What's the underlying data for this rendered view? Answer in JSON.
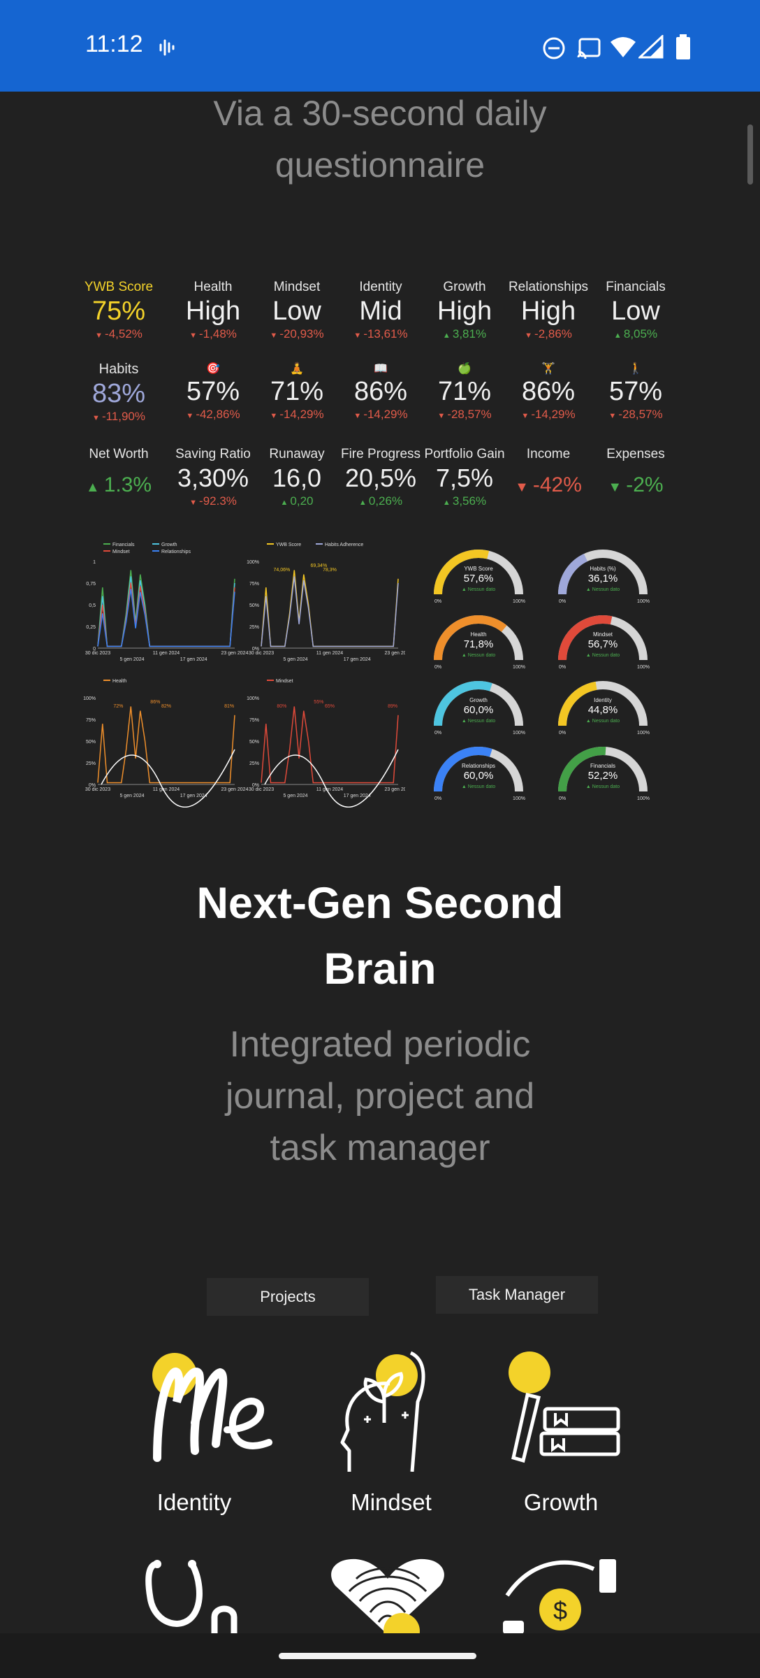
{
  "status_bar": {
    "time": "11:12"
  },
  "hero": {
    "subtitle_line1": "Via a 30-second daily",
    "subtitle_line2": "questionnaire"
  },
  "metrics": {
    "row1": [
      {
        "label": "YWB Score",
        "value": "75%",
        "change": "-4,52%",
        "dir": "down"
      },
      {
        "label": "Health",
        "value": "High",
        "change": "-1,48%",
        "dir": "down"
      },
      {
        "label": "Mindset",
        "value": "Low",
        "change": "-20,93%",
        "dir": "down"
      },
      {
        "label": "Identity",
        "value": "Mid",
        "change": "-13,61%",
        "dir": "down"
      },
      {
        "label": "Growth",
        "value": "High",
        "change": "3,81%",
        "dir": "up"
      },
      {
        "label": "Relationships",
        "value": "High",
        "change": "-2,86%",
        "dir": "down"
      },
      {
        "label": "Financials",
        "value": "Low",
        "change": "8,05%",
        "dir": "up"
      }
    ],
    "row2": [
      {
        "label": "Habits",
        "value": "83%",
        "change": "-11,90%",
        "dir": "down"
      },
      {
        "label": "🎯",
        "value": "57%",
        "change": "-42,86%",
        "dir": "down"
      },
      {
        "label": "🧘",
        "value": "71%",
        "change": "-14,29%",
        "dir": "down"
      },
      {
        "label": "📖",
        "value": "86%",
        "change": "-14,29%",
        "dir": "down"
      },
      {
        "label": "🍏",
        "value": "71%",
        "change": "-28,57%",
        "dir": "down"
      },
      {
        "label": "🏋",
        "value": "86%",
        "change": "-14,29%",
        "dir": "down"
      },
      {
        "label": "🚶",
        "value": "57%",
        "change": "-28,57%",
        "dir": "down"
      }
    ],
    "row3": [
      {
        "label": "Net Worth",
        "value": "1.3%",
        "change": "",
        "dir": "up"
      },
      {
        "label": "Saving Ratio",
        "value": "3,30%",
        "change": "-92.3%",
        "dir": "down"
      },
      {
        "label": "Runaway",
        "value": "16,0",
        "change": "0,20",
        "dir": "up"
      },
      {
        "label": "Fire Progress",
        "value": "20,5%",
        "change": "0,26%",
        "dir": "up"
      },
      {
        "label": "Portfolio Gain",
        "value": "7,5%",
        "change": "3,56%",
        "dir": "up"
      },
      {
        "label": "Income",
        "value": "-42%",
        "change": "",
        "dir": "down"
      },
      {
        "label": "Expenses",
        "value": "-2%",
        "change": "",
        "dir": "down"
      }
    ]
  },
  "line_charts": {
    "chart1": {
      "legend": [
        "Financials",
        "Growth",
        "Mindset",
        "Relationships"
      ],
      "y_ticks": [
        "1",
        "0,75",
        "0,5",
        "0,25",
        "0"
      ],
      "x_ticks": [
        "30 dic 2023",
        "11 gen 2024",
        "23 gen 2024"
      ],
      "x_ticks2": [
        "5 gen 2024",
        "17 gen 2024"
      ]
    },
    "chart2": {
      "legend": [
        "YWB Score",
        "Habits Adherence"
      ],
      "y_ticks": [
        "100%",
        "75%",
        "50%",
        "25%",
        "0%"
      ],
      "x_ticks": [
        "30 dic 2023",
        "11 gen 2024",
        "23 gen 2024"
      ],
      "x_ticks2": [
        "5 gen 2024",
        "17 gen 2024"
      ],
      "labels": [
        "74,06%",
        "69,34%",
        "78,3%"
      ]
    },
    "chart3": {
      "legend": [
        "Health"
      ],
      "y_ticks": [
        "100%",
        "75%",
        "50%",
        "25%",
        "0%"
      ],
      "x_ticks": [
        "30 dic 2023",
        "11 gen 2024",
        "23 gen 2024"
      ],
      "x_ticks2": [
        "5 gen 2024",
        "17 gen 2024"
      ],
      "labels": [
        "72%",
        "86%",
        "82%",
        "81%"
      ]
    },
    "chart4": {
      "legend": [
        "Mindset"
      ],
      "y_ticks": [
        "100%",
        "75%",
        "50%",
        "25%",
        "0%"
      ],
      "x_ticks": [
        "30 dic 2023",
        "11 gen 2024",
        "23 gen 2024"
      ],
      "x_ticks2": [
        "5 gen 2024",
        "17 gen 2024"
      ],
      "labels": [
        "80%",
        "55%",
        "65%",
        "89%"
      ]
    }
  },
  "gauges": [
    {
      "title": "YWB Score",
      "value": "57,6%",
      "note": "Nessun dato",
      "fraction": 0.576,
      "color": "#f3c623"
    },
    {
      "title": "Habits (%)",
      "value": "36,1%",
      "note": "Nessun dato",
      "fraction": 0.361,
      "color": "#9fa8da"
    },
    {
      "title": "Health",
      "value": "71,8%",
      "note": "Nessun dato",
      "fraction": 0.718,
      "color": "#ef8f2b"
    },
    {
      "title": "Mindset",
      "value": "56,7%",
      "note": "Nessun dato",
      "fraction": 0.567,
      "color": "#e04a3a"
    },
    {
      "title": "Growth",
      "value": "60,0%",
      "note": "Nessun dato",
      "fraction": 0.6,
      "color": "#4ec5e0"
    },
    {
      "title": "Identity",
      "value": "44,8%",
      "note": "Nessun dato",
      "fraction": 0.448,
      "color": "#f3c623"
    },
    {
      "title": "Relationships",
      "value": "60,0%",
      "note": "Nessun dato",
      "fraction": 0.6,
      "color": "#3b82f6"
    },
    {
      "title": "Financials",
      "value": "52,2%",
      "note": "Nessun dato",
      "fraction": 0.522,
      "color": "#43a047"
    }
  ],
  "gauge_min": "0%",
  "gauge_max": "100%",
  "section": {
    "title_line1": "Next-Gen Second",
    "title_line2": "Brain",
    "sub_line1": "Integrated periodic",
    "sub_line2": "journal, project and",
    "sub_line3": "task manager"
  },
  "tabs": {
    "projects": "Projects",
    "task_manager": "Task Manager"
  },
  "pillars": [
    {
      "label": "Identity",
      "icon": "me-icon"
    },
    {
      "label": "Mindset",
      "icon": "head-plant-icon"
    },
    {
      "label": "Growth",
      "icon": "books-icon"
    }
  ],
  "pillars_row2": [
    {
      "icon": "stethoscope-icon"
    },
    {
      "icon": "fingerprint-heart-icon"
    },
    {
      "icon": "hand-coin-icon"
    }
  ],
  "colors": {
    "status_bar": "#1565d1",
    "background": "#212121",
    "accent_yellow": "#f3d22a"
  }
}
